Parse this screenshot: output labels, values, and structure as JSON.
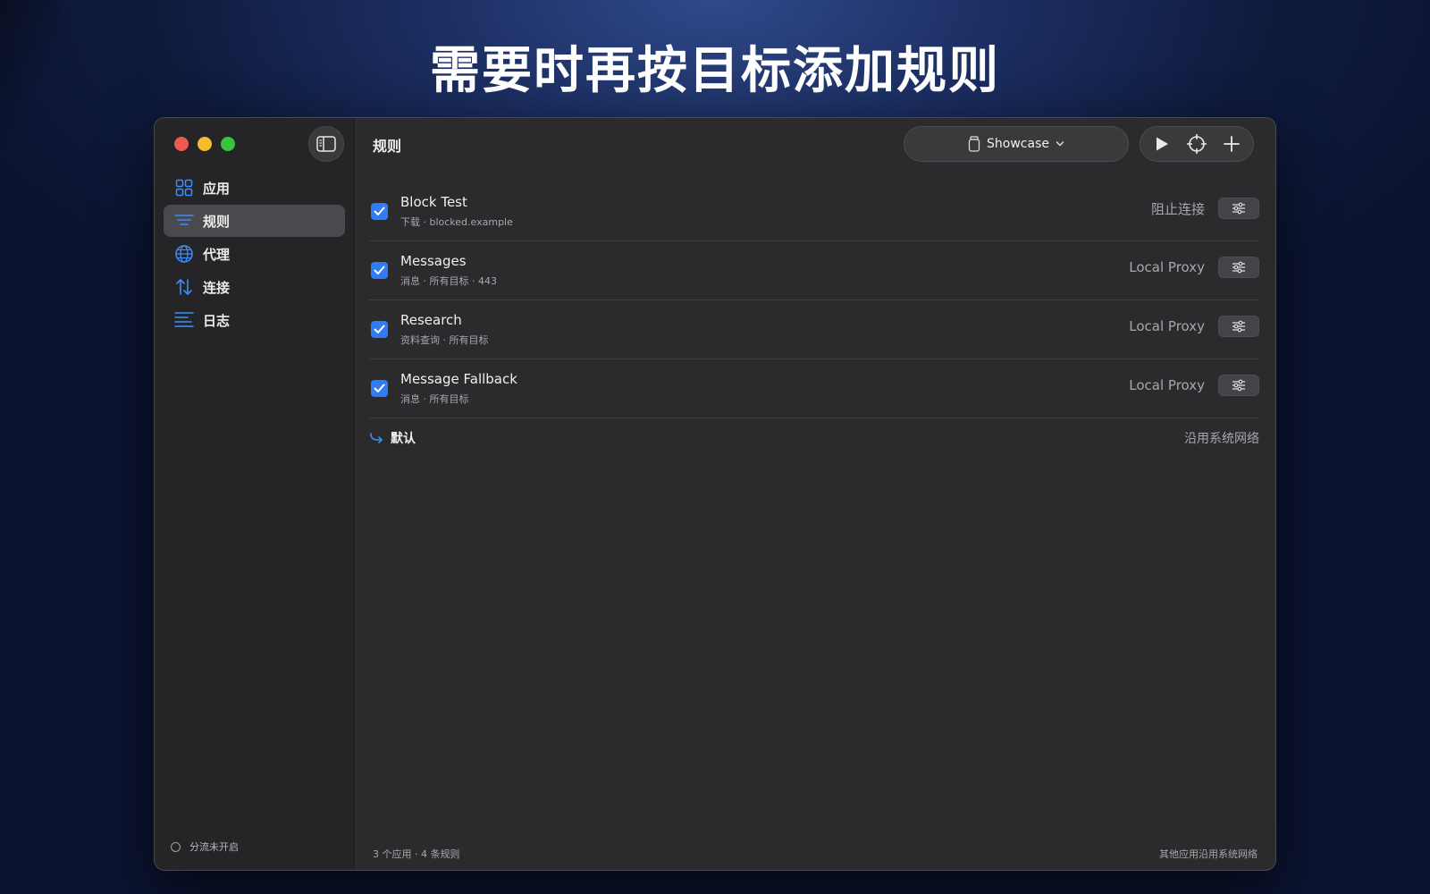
{
  "headline": "需要时再按目标添加规则",
  "sidebar": {
    "items": [
      {
        "label": "应用"
      },
      {
        "label": "规则"
      },
      {
        "label": "代理"
      },
      {
        "label": "连接"
      },
      {
        "label": "日志"
      }
    ],
    "footer_status": "分流未开启"
  },
  "toolbar": {
    "title": "规则",
    "profile_label": "Showcase"
  },
  "rules": [
    {
      "name": "Block Test",
      "sub": "下载 · blocked.example",
      "target": "阻止连接"
    },
    {
      "name": "Messages",
      "sub": "消息 · 所有目标 · 443",
      "target": "Local Proxy"
    },
    {
      "name": "Research",
      "sub": "资料查询 · 所有目标",
      "target": "Local Proxy"
    },
    {
      "name": "Message Fallback",
      "sub": "消息 · 所有目标",
      "target": "Local Proxy"
    }
  ],
  "default_rule": {
    "label": "默认",
    "target": "沿用系统网络"
  },
  "statusbar": {
    "left": "3 个应用 · 4 条规则",
    "right": "其他应用沿用系统网络"
  },
  "colors": {
    "accent": "#2f7cf6",
    "icon_blue": "#3d8ef8"
  }
}
